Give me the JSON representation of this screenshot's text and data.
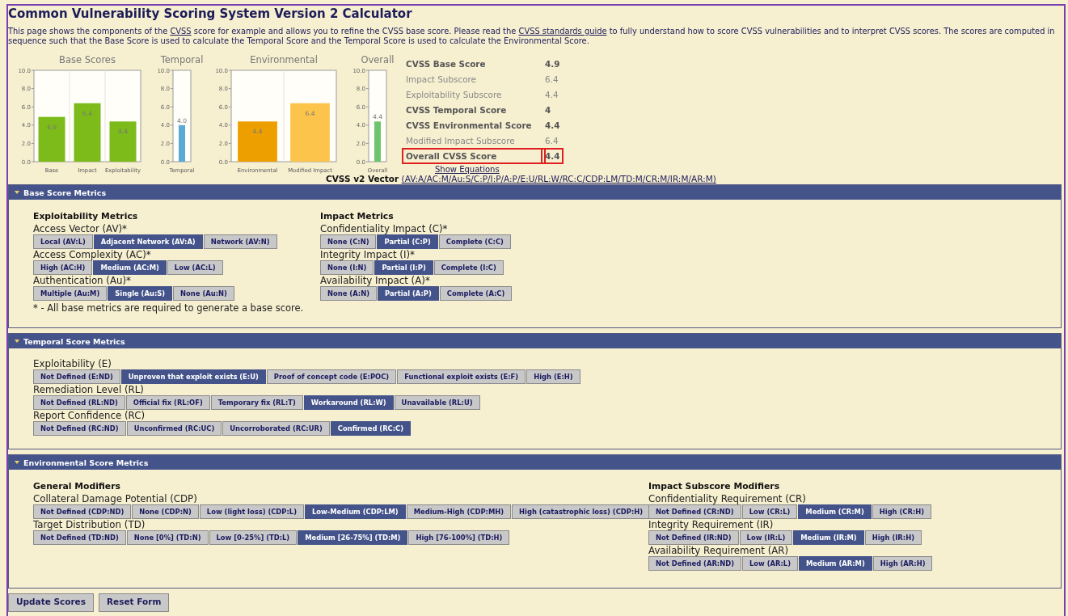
{
  "title": "Common Vulnerability Scoring System Version 2 Calculator",
  "intro": [
    {
      "text": "This page shows the components of the "
    },
    {
      "link": "CVSS"
    },
    {
      "text": " score for example and allows you to refine the CVSS base score. Please read the "
    },
    {
      "link": "CVSS standards guide"
    },
    {
      "text": " to fully understand how to score CVSS vulnerabilities and to interpret CVSS scores. The scores are computed in sequence such that the Base Score is used to calculate the Temporal Score and the Temporal Score is used to calculate the Environmental Score."
    }
  ],
  "charts": [
    {
      "chart_data": {
        "type": "bar",
        "title": "Base Scores",
        "categories": [
          "Base",
          "Impact",
          "Exploitability"
        ],
        "series": [
          {
            "color": "#7cbb1a",
            "values": [
              4.9,
              6.4,
              4.4
            ]
          }
        ],
        "ylim": [
          0,
          10
        ],
        "yticks": [
          {
            "value": 0,
            "label": "0.0"
          },
          {
            "value": 2,
            "label": "2.0"
          },
          {
            "value": 4,
            "label": "4.0"
          },
          {
            "value": 6,
            "label": "6.0"
          },
          {
            "value": 8,
            "label": "8.0"
          },
          {
            "value": 10,
            "label": "10.0"
          }
        ],
        "value_labels": [
          "4.9",
          "6.4",
          "4.4"
        ]
      }
    },
    {
      "chart_data": {
        "type": "bar",
        "title": "Temporal",
        "categories": [
          "Temporal"
        ],
        "series": [
          {
            "color": "#59aad6",
            "values": [
              4.0
            ]
          }
        ],
        "ylim": [
          0,
          10
        ],
        "yticks": [
          {
            "value": 0,
            "label": "0.0"
          },
          {
            "value": 2,
            "label": "2.0"
          },
          {
            "value": 4,
            "label": "4.0"
          },
          {
            "value": 6,
            "label": "6.0"
          },
          {
            "value": 8,
            "label": "8.0"
          },
          {
            "value": 10,
            "label": "10.0"
          }
        ],
        "value_labels": [
          "4.0"
        ]
      }
    },
    {
      "chart_data": {
        "type": "bar",
        "title": "Environmental",
        "categories": [
          "Environmental",
          "Modified Impact"
        ],
        "series": [
          {
            "color": "#ee9f00",
            "values": [
              4.4,
              null
            ]
          },
          {
            "color": "#fdc44c",
            "values": [
              null,
              6.4
            ]
          }
        ],
        "ylim": [
          0,
          10
        ],
        "yticks": [
          {
            "value": 0,
            "label": "0.0"
          },
          {
            "value": 2,
            "label": "2.0"
          },
          {
            "value": 4,
            "label": "4.0"
          },
          {
            "value": 6,
            "label": "6.0"
          },
          {
            "value": 8,
            "label": "8.0"
          },
          {
            "value": 10,
            "label": "10.0"
          }
        ],
        "value_labels": [
          "4.4",
          "6.4"
        ]
      }
    },
    {
      "chart_data": {
        "type": "bar",
        "title": "Overall",
        "categories": [
          "Overall"
        ],
        "series": [
          {
            "color": "#6cc56c",
            "values": [
              4.4
            ]
          }
        ],
        "ylim": [
          0,
          10
        ],
        "yticks": [
          {
            "value": 0,
            "label": "0.0"
          },
          {
            "value": 2,
            "label": "2.0"
          },
          {
            "value": 4,
            "label": "4.0"
          },
          {
            "value": 6,
            "label": "6.0"
          },
          {
            "value": 8,
            "label": "8.0"
          },
          {
            "value": 10,
            "label": "10.0"
          }
        ],
        "value_labels": [
          "4.4"
        ]
      }
    }
  ],
  "scores": [
    {
      "label": "CVSS Base Score",
      "value": "4.9",
      "kind": "total",
      "highlighted": false
    },
    {
      "label": "Impact Subscore",
      "value": "6.4",
      "kind": "sub",
      "highlighted": false
    },
    {
      "label": "Exploitability Subscore",
      "value": "4.4",
      "kind": "sub",
      "highlighted": false
    },
    {
      "label": "CVSS Temporal Score",
      "value": "4",
      "kind": "total",
      "highlighted": false
    },
    {
      "label": "CVSS Environmental Score",
      "value": "4.4",
      "kind": "total",
      "highlighted": false
    },
    {
      "label": "Modified Impact Subscore",
      "value": "6.4",
      "kind": "sub",
      "highlighted": false
    },
    {
      "label": "Overall CVSS Score",
      "value": "4.4",
      "kind": "total",
      "highlighted": true
    }
  ],
  "equations_link": "Show Equations",
  "vector": {
    "label": "CVSS v2 Vector",
    "value": "(AV:A/AC:M/Au:S/C:P/I:P/A:P/E:U/RL:W/RC:C/CDP:LM/TD:M/CR:M/IR:M/AR:M)"
  },
  "sections": [
    {
      "kind": "base",
      "title": "Base Score Metrics",
      "columns": [
        {
          "heading": "Exploitability Metrics",
          "metrics": [
            {
              "label": "Access Vector (AV)*",
              "options": [
                {
                  "label": "Local (AV:L)",
                  "selected": false
                },
                {
                  "label": "Adjacent Network (AV:A)",
                  "selected": true
                },
                {
                  "label": "Network (AV:N)",
                  "selected": false
                }
              ]
            },
            {
              "label": "Access Complexity (AC)*",
              "options": [
                {
                  "label": "High (AC:H)",
                  "selected": false
                },
                {
                  "label": "Medium (AC:M)",
                  "selected": true
                },
                {
                  "label": "Low (AC:L)",
                  "selected": false
                }
              ]
            },
            {
              "label": "Authentication (Au)*",
              "options": [
                {
                  "label": "Multiple (Au:M)",
                  "selected": false
                },
                {
                  "label": "Single (Au:S)",
                  "selected": true
                },
                {
                  "label": "None (Au:N)",
                  "selected": false
                }
              ]
            }
          ],
          "note": "* - All base metrics are required to generate a base score."
        },
        {
          "heading": "Impact Metrics",
          "metrics": [
            {
              "label": "Confidentiality Impact (C)*",
              "options": [
                {
                  "label": "None (C:N)",
                  "selected": false
                },
                {
                  "label": "Partial (C:P)",
                  "selected": true
                },
                {
                  "label": "Complete (C:C)",
                  "selected": false
                }
              ]
            },
            {
              "label": "Integrity Impact (I)*",
              "options": [
                {
                  "label": "None (I:N)",
                  "selected": false
                },
                {
                  "label": "Partial (I:P)",
                  "selected": true
                },
                {
                  "label": "Complete (I:C)",
                  "selected": false
                }
              ]
            },
            {
              "label": "Availability Impact (A)*",
              "options": [
                {
                  "label": "None (A:N)",
                  "selected": false
                },
                {
                  "label": "Partial (A:P)",
                  "selected": true
                },
                {
                  "label": "Complete (A:C)",
                  "selected": false
                }
              ]
            }
          ]
        }
      ]
    },
    {
      "kind": "temporal",
      "title": "Temporal Score Metrics",
      "columns": [
        {
          "metrics": [
            {
              "label": "Exploitability (E)",
              "options": [
                {
                  "label": "Not Defined (E:ND)",
                  "selected": false
                },
                {
                  "label": "Unproven that exploit exists (E:U)",
                  "selected": true
                },
                {
                  "label": "Proof of concept code (E:POC)",
                  "selected": false
                },
                {
                  "label": "Functional exploit exists (E:F)",
                  "selected": false
                },
                {
                  "label": "High (E:H)",
                  "selected": false
                }
              ]
            },
            {
              "label": "Remediation Level (RL)",
              "options": [
                {
                  "label": "Not Defined (RL:ND)",
                  "selected": false
                },
                {
                  "label": "Official fix (RL:OF)",
                  "selected": false
                },
                {
                  "label": "Temporary fix (RL:T)",
                  "selected": false
                },
                {
                  "label": "Workaround (RL:W)",
                  "selected": true
                },
                {
                  "label": "Unavailable (RL:U)",
                  "selected": false
                }
              ]
            },
            {
              "label": "Report Confidence (RC)",
              "options": [
                {
                  "label": "Not Defined (RC:ND)",
                  "selected": false
                },
                {
                  "label": "Unconfirmed (RC:UC)",
                  "selected": false
                },
                {
                  "label": "Uncorroborated (RC:UR)",
                  "selected": false
                },
                {
                  "label": "Confirmed (RC:C)",
                  "selected": true
                }
              ]
            }
          ]
        }
      ]
    },
    {
      "kind": "environmental",
      "title": "Environmental Score Metrics",
      "columns": [
        {
          "heading": "General Modifiers",
          "metrics": [
            {
              "label": "Collateral Damage Potential (CDP)",
              "options": [
                {
                  "label": "Not Defined (CDP:ND)",
                  "selected": false
                },
                {
                  "label": "None (CDP:N)",
                  "selected": false
                },
                {
                  "label": "Low (light loss) (CDP:L)",
                  "selected": false
                },
                {
                  "label": "Low-Medium (CDP:LM)",
                  "selected": true
                },
                {
                  "label": "Medium-High (CDP:MH)",
                  "selected": false
                },
                {
                  "label": "High (catastrophic loss) (CDP:H)",
                  "selected": false
                }
              ]
            },
            {
              "label": "Target Distribution (TD)",
              "options": [
                {
                  "label": "Not Defined (TD:ND)",
                  "selected": false
                },
                {
                  "label": "None [0%] (TD:N)",
                  "selected": false
                },
                {
                  "label": "Low [0-25%] (TD:L)",
                  "selected": false
                },
                {
                  "label": "Medium [26-75%] (TD:M)",
                  "selected": true
                },
                {
                  "label": "High [76-100%] (TD:H)",
                  "selected": false
                }
              ]
            }
          ]
        },
        {
          "heading": "Impact Subscore Modifiers",
          "metrics": [
            {
              "label": "Confidentiality Requirement (CR)",
              "options": [
                {
                  "label": "Not Defined (CR:ND)",
                  "selected": false
                },
                {
                  "label": "Low (CR:L)",
                  "selected": false
                },
                {
                  "label": "Medium (CR:M)",
                  "selected": true
                },
                {
                  "label": "High (CR:H)",
                  "selected": false
                }
              ]
            },
            {
              "label": "Integrity Requirement (IR)",
              "options": [
                {
                  "label": "Not Defined (IR:ND)",
                  "selected": false
                },
                {
                  "label": "Low (IR:L)",
                  "selected": false
                },
                {
                  "label": "Medium (IR:M)",
                  "selected": true
                },
                {
                  "label": "High (IR:H)",
                  "selected": false
                }
              ]
            },
            {
              "label": "Availability Requirement (AR)",
              "options": [
                {
                  "label": "Not Defined (AR:ND)",
                  "selected": false
                },
                {
                  "label": "Low (AR:L)",
                  "selected": false
                },
                {
                  "label": "Medium (AR:M)",
                  "selected": true
                },
                {
                  "label": "High (AR:H)",
                  "selected": false
                }
              ]
            }
          ]
        }
      ]
    }
  ],
  "buttons": [
    "Update Scores",
    "Reset Form"
  ]
}
